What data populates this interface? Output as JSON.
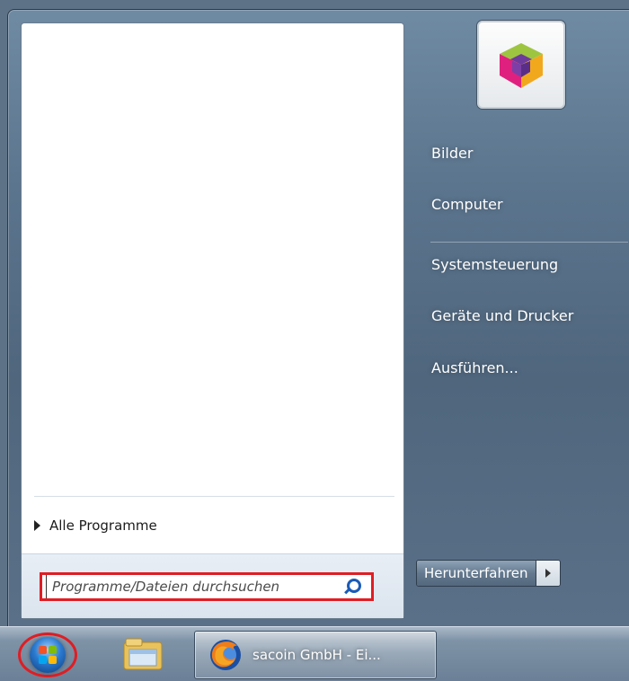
{
  "left_pane": {
    "all_programs_label": "Alle Programme",
    "search": {
      "placeholder": "Programme/Dateien durchsuchen"
    }
  },
  "right_pane": {
    "items": [
      {
        "label": "Bilder"
      },
      {
        "label": "Computer"
      },
      {
        "label": "Systemsteuerung"
      },
      {
        "label": "Geräte und Drucker"
      },
      {
        "label": "Ausführen..."
      }
    ],
    "user_tile_icon": "colorful-cube-icon"
  },
  "shutdown": {
    "label": "Herunterfahren"
  },
  "taskbar": {
    "start_icon": "windows-orb-icon",
    "pinned": [
      {
        "icon": "windows-explorer-icon"
      }
    ],
    "windows": [
      {
        "icon": "firefox-icon",
        "label": "sacoin GmbH - Ei..."
      }
    ]
  },
  "colors": {
    "highlight_red": "#e01d23",
    "search_icon_blue": "#1a5bb8"
  }
}
